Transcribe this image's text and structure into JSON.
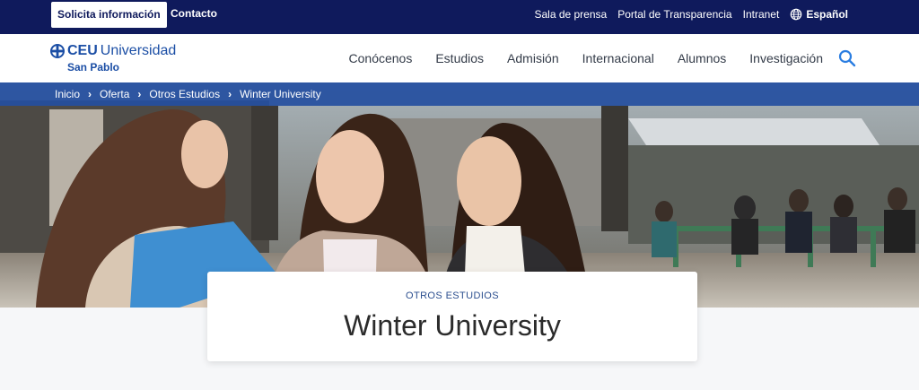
{
  "topbar": {
    "solicita_label": "Solicita información",
    "contacto_label": "Contacto",
    "links": [
      "Sala de prensa",
      "Portal de Transparencia",
      "Intranet"
    ],
    "language": "Español",
    "language_icon": "globe-icon"
  },
  "header": {
    "logo_main": "Universidad",
    "logo_ceu": "CEU",
    "logo_sub": "San Pablo",
    "nav": [
      "Conócenos",
      "Estudios",
      "Admisión",
      "Internacional",
      "Alumnos",
      "Investigación"
    ],
    "search_icon": "search-icon"
  },
  "breadcrumb": [
    "Inicio",
    "Oferta",
    "Otros Estudios",
    "Winter University"
  ],
  "hero": {
    "eyebrow": "OTROS ESTUDIOS",
    "title": "Winter University"
  },
  "colors": {
    "topbar_bg": "#0f1a5c",
    "brand_blue": "#1b4ea5",
    "breadcrumb_bg": "#244ea0",
    "page_bg": "#f6f7f9"
  }
}
